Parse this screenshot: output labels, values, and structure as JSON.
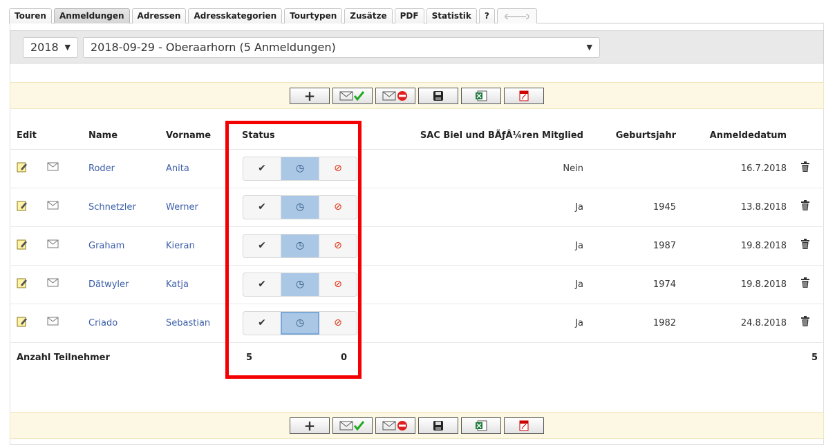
{
  "tabs": [
    {
      "label": "Touren",
      "state": "normal"
    },
    {
      "label": "Anmeldungen",
      "state": "active"
    },
    {
      "label": "Adressen",
      "state": "normal"
    },
    {
      "label": "Adresskategorien",
      "state": "normal"
    },
    {
      "label": "Tourtypen",
      "state": "normal"
    },
    {
      "label": "Zusätze",
      "state": "normal"
    },
    {
      "label": "PDF",
      "state": "normal"
    },
    {
      "label": "Statistik",
      "state": "normal"
    },
    {
      "label": "?",
      "state": "normal"
    }
  ],
  "selectors": {
    "year": "2018",
    "tour": "2018-09-29 - Oberaarhorn (5 Anmeldungen)"
  },
  "toolbar_icons": [
    "plus-icon",
    "mail-confirm-icon",
    "mail-reject-icon",
    "save-icon",
    "excel-icon",
    "pdf-icon"
  ],
  "table": {
    "headers": {
      "edit": "Edit",
      "name": "Name",
      "vorname": "Vorname",
      "status": "Status",
      "member": "SAC Biel und BÃƒÂ¼ren Mitglied",
      "year": "Geburtsjahr",
      "date": "Anmeldedatum"
    },
    "rows": [
      {
        "name": "Roder",
        "vorname": "Anita",
        "member": "Nein",
        "year": "",
        "date": "16.7.2018"
      },
      {
        "name": "Schnetzler",
        "vorname": "Werner",
        "member": "Ja",
        "year": "1945",
        "date": "13.8.2018"
      },
      {
        "name": "Graham",
        "vorname": "Kieran",
        "member": "Ja",
        "year": "1987",
        "date": "19.8.2018"
      },
      {
        "name": "Dätwyler",
        "vorname": "Katja",
        "member": "Ja",
        "year": "1974",
        "date": "19.8.2018"
      },
      {
        "name": "Criado",
        "vorname": "Sebastian",
        "member": "Ja",
        "year": "1982",
        "date": "24.8.2018"
      }
    ],
    "status_glyphs": {
      "confirm": "✔",
      "pending": "◷",
      "reject": "⊘"
    }
  },
  "footer": {
    "label": "Anzahl Teilnehmer",
    "pending_count": "5",
    "reject_count": "0",
    "total": "5"
  },
  "colors": {
    "link": "#3b5ea8",
    "highlight": "#f50000",
    "toolbar_bg": "#fcf8e3",
    "status_selected": "#aac8e6"
  }
}
